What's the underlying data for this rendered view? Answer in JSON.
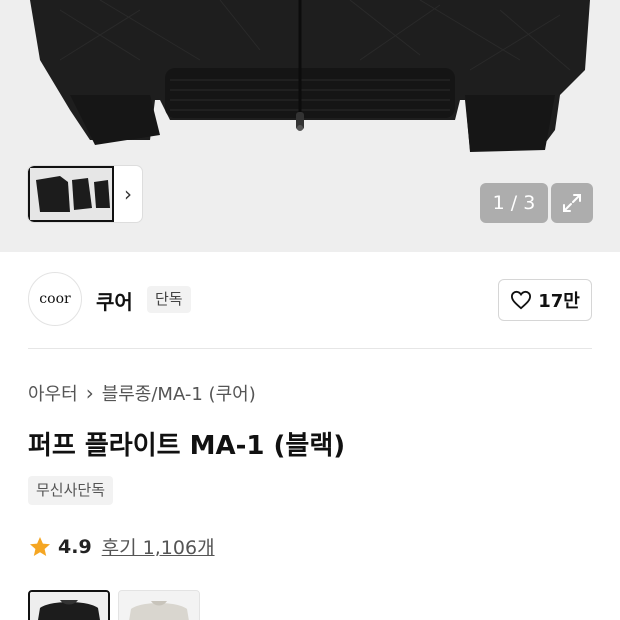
{
  "gallery": {
    "pager_text": "1 / 3",
    "thumbnail_next": "›"
  },
  "brand": {
    "logo_text": "coor",
    "name": "쿠어",
    "tag": "단독",
    "likes": "17만"
  },
  "breadcrumb": {
    "category": "아우터",
    "separator": "›",
    "subcategory": "블루종/MA-1 (쿠어)"
  },
  "product": {
    "title": "퍼프 플라이트 MA-1 (블랙)",
    "exclusive_badge": "무신사단독",
    "rating": "4.9",
    "reviews": "후기 1,106개"
  },
  "colors": {
    "star": "#f5a623",
    "jacket": "#1c1c1c",
    "background": "#efefef"
  }
}
